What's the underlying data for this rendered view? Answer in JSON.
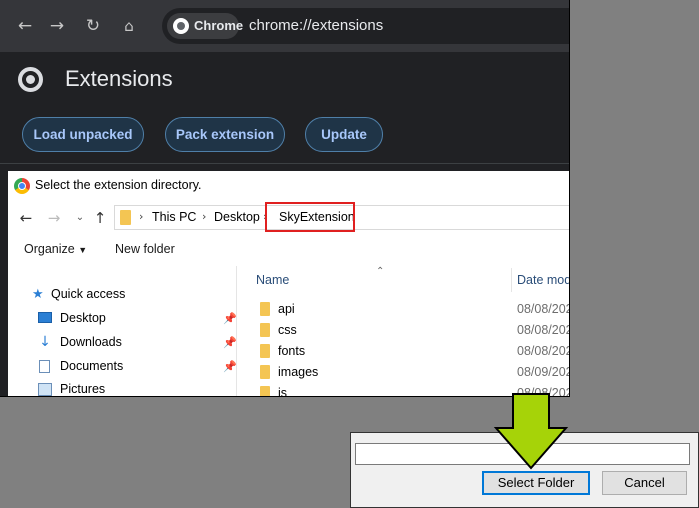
{
  "browser": {
    "chip_label": "Chrome",
    "url": "chrome://extensions"
  },
  "extensions_page": {
    "title": "Extensions",
    "buttons": {
      "load_unpacked": "Load unpacked",
      "pack_extension": "Pack extension",
      "update": "Update"
    }
  },
  "dialog": {
    "title": "Select the extension directory.",
    "breadcrumb": [
      "This PC",
      "Desktop",
      "SkyExtension"
    ],
    "commands": {
      "organize": "Organize",
      "new_folder": "New folder"
    },
    "nav_items": [
      "Quick access",
      "Desktop",
      "Downloads",
      "Documents",
      "Pictures"
    ],
    "columns": {
      "name": "Name",
      "date": "Date mod"
    },
    "files": [
      {
        "name": "api",
        "date": "08/08/202"
      },
      {
        "name": "css",
        "date": "08/08/202"
      },
      {
        "name": "fonts",
        "date": "08/08/202"
      },
      {
        "name": "images",
        "date": "08/09/202"
      },
      {
        "name": "js",
        "date": "08/08/202"
      }
    ],
    "select_folder": "Select Folder",
    "cancel": "Cancel"
  },
  "colors": {
    "accent": "#a8c7fa",
    "highlight": "#e02020",
    "arrow": "#a6d308"
  }
}
